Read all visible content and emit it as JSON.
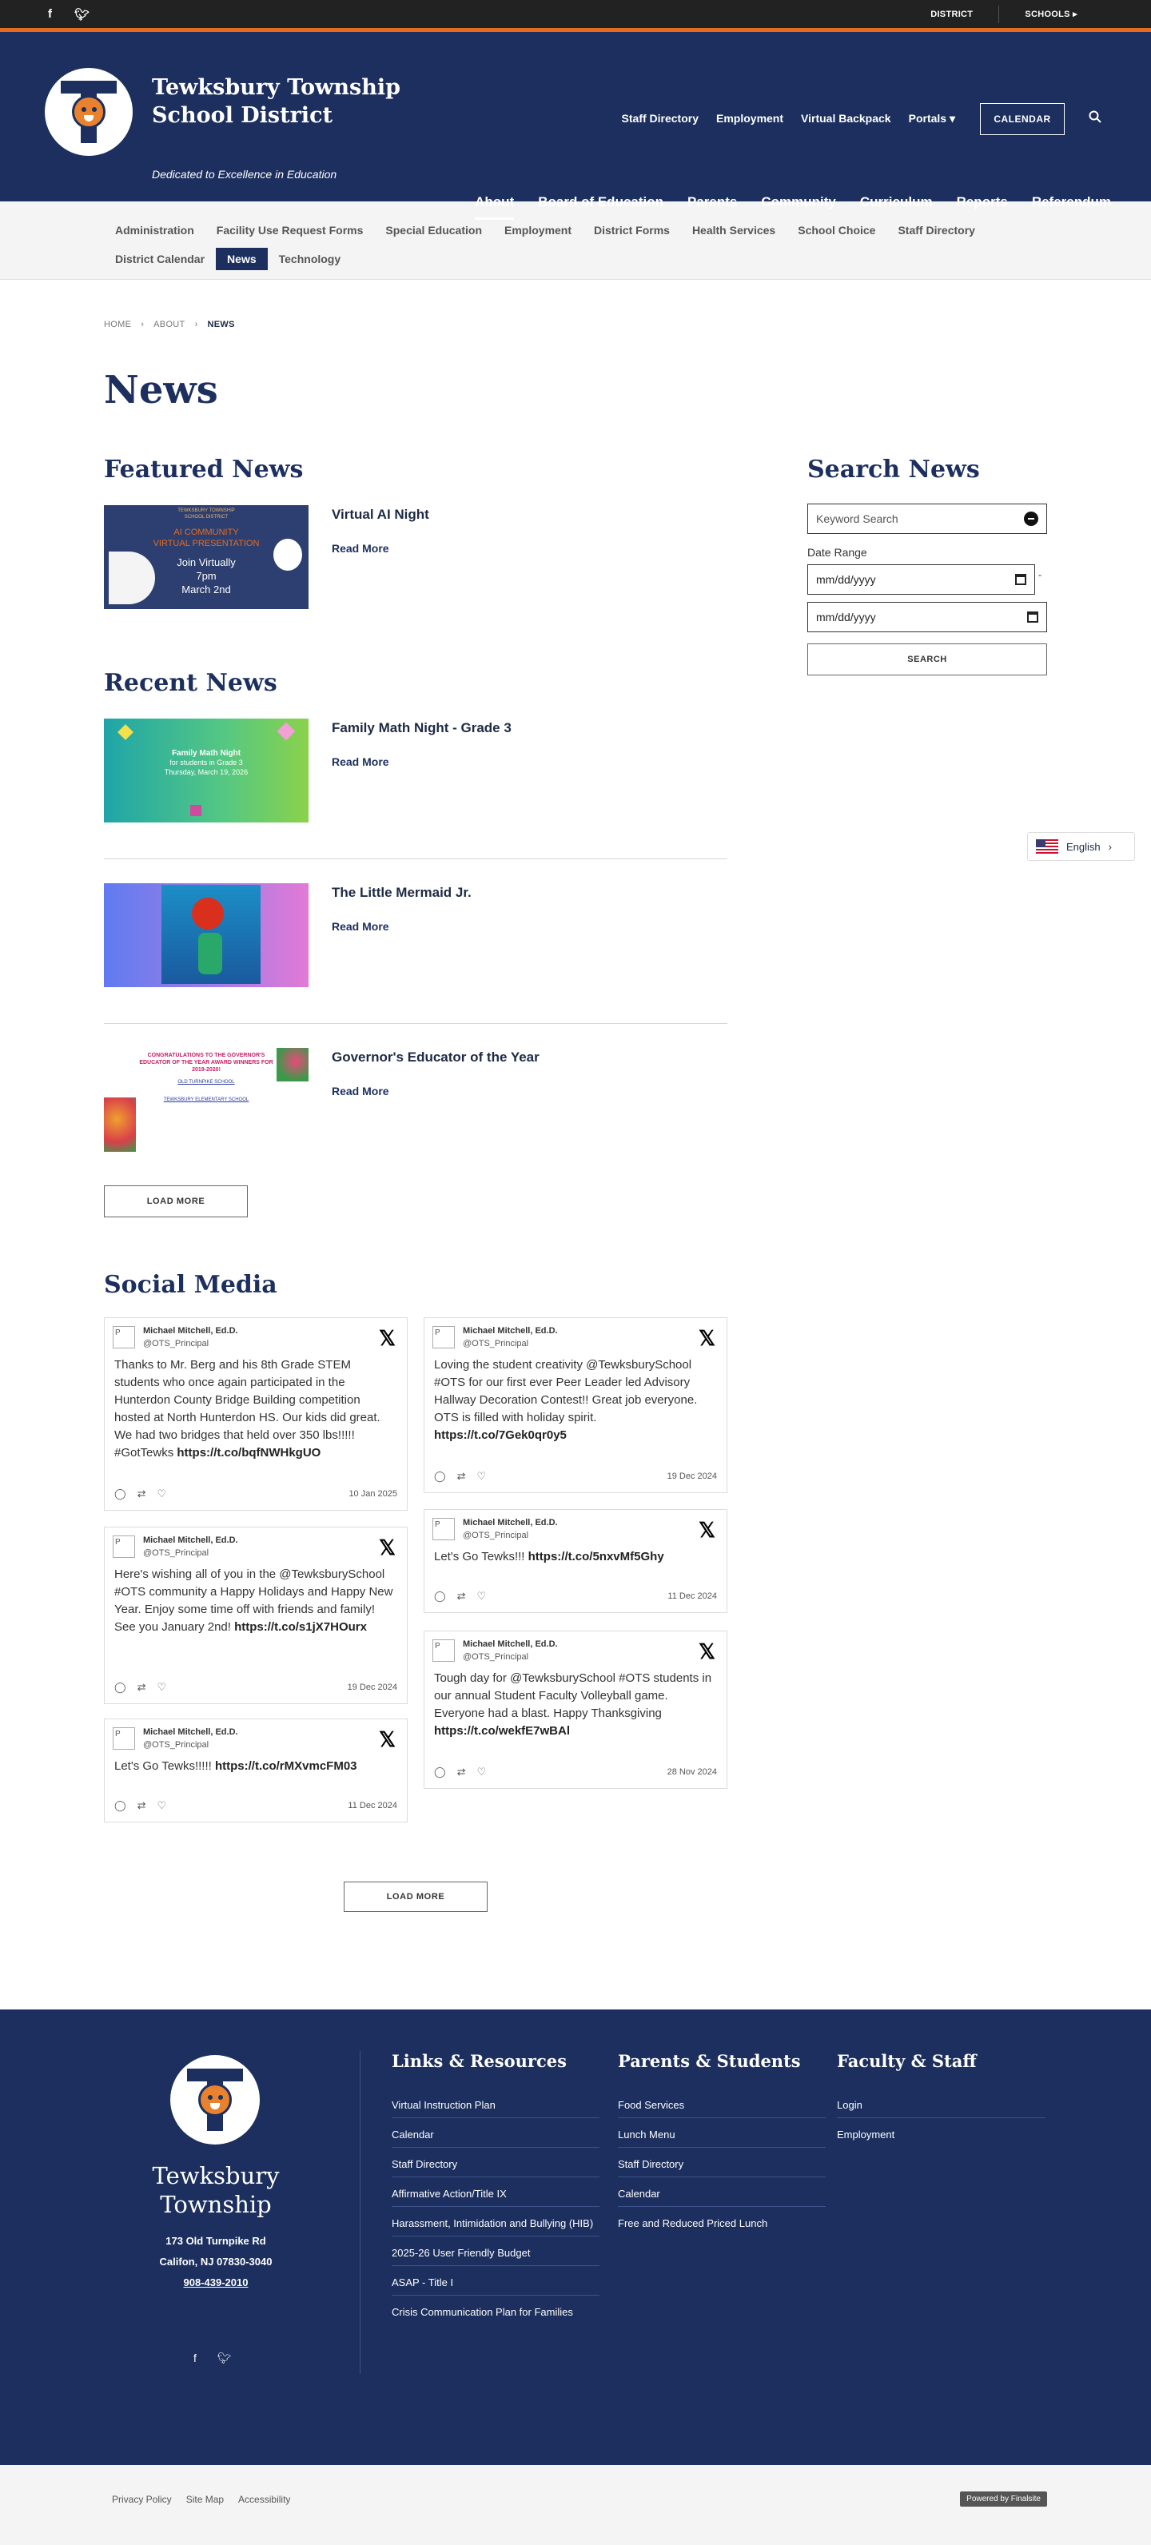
{
  "topbar": {
    "facebook_icon": "facebook-icon",
    "twitter_icon": "twitter-icon",
    "district": "DISTRICT",
    "schools": "SCHOOLS ▸"
  },
  "header": {
    "title_line1": "Tewksbury Township",
    "title_line2": "School District",
    "tagline": "Dedicated to Excellence in Education",
    "util_nav": [
      "Staff Directory",
      "Employment",
      "Virtual Backpack",
      "Portals ▾"
    ],
    "calendar": "CALENDAR",
    "main_nav": [
      "About",
      "Board of Education",
      "Parents",
      "Community",
      "Curriculum",
      "Reports",
      "Referendum"
    ]
  },
  "subnav": {
    "row1": [
      "Administration",
      "Facility Use Request Forms",
      "Special Education",
      "Employment",
      "District Forms",
      "Health Services",
      "School Choice",
      "Staff Directory"
    ],
    "row2": [
      "District Calendar",
      "News",
      "Technology"
    ]
  },
  "breadcrumb": [
    "HOME",
    "ABOUT",
    "NEWS"
  ],
  "page_title": "News",
  "featured": {
    "heading": "Featured News",
    "item": {
      "title": "Virtual AI Night",
      "read_more": "Read More",
      "thumb_lines": [
        "TEWKSBURY TOWNSHIP",
        "SCHOOL DISTRICT",
        "AI COMMUNITY",
        "VIRTUAL PRESENTATION",
        "Join Virtually",
        "7pm",
        "March 2nd"
      ]
    }
  },
  "recent": {
    "heading": "Recent News",
    "items": [
      {
        "title": "Family Math Night - Grade 3",
        "read_more": "Read More",
        "thumb_lines": [
          "Family Math Night",
          "for students in Grade 3",
          "Thursday, March 19, 2026"
        ]
      },
      {
        "title": "The Little Mermaid Jr.",
        "read_more": "Read More"
      },
      {
        "title": "Governor's Educator of the Year",
        "read_more": "Read More",
        "thumb_lines": [
          "CONGRATULATIONS TO THE GOVERNOR'S",
          "EDUCATOR OF THE YEAR AWARD WINNERS FOR",
          "2019-2020!",
          "OLD TURNPIKE SCHOOL",
          "TEWKSBURY ELEMENTARY SCHOOL"
        ]
      }
    ],
    "load_more": "LOAD MORE"
  },
  "search": {
    "heading": "Search News",
    "keyword_placeholder": "Keyword Search",
    "date_label": "Date Range",
    "date_placeholder": "mm/dd/yyyy",
    "button": "SEARCH"
  },
  "language": "English",
  "social": {
    "heading": "Social Media",
    "load_more": "LOAD MORE",
    "tweets": [
      {
        "name": "Michael Mitchell, Ed.D.",
        "handle": "@OTS_Principal",
        "text": "Thanks to Mr. Berg and his 8th Grade STEM students who once again participated in the Hunterdon County Bridge Building competition hosted at North Hunterdon HS. Our kids did great. We had two bridges that held over 350 lbs!!!!! #GotTewks",
        "link": "https://t.co/bqfNWHkgUO",
        "date": "10 Jan 2025"
      },
      {
        "name": "Michael Mitchell, Ed.D.",
        "handle": "@OTS_Principal",
        "text": "Loving the student creativity @TewksburySchool #OTS for our first ever Peer Leader led Advisory Hallway Decoration Contest!! Great job everyone. OTS is filled with holiday spirit.",
        "link": "https://t.co/7Gek0qr0y5",
        "date": "19 Dec 2024"
      },
      {
        "name": "Michael Mitchell, Ed.D.",
        "handle": "@OTS_Principal",
        "text": "Here's wishing all of you in the @TewksburySchool #OTS community a Happy Holidays and Happy New Year. Enjoy some time off with friends and family! See you January 2nd!",
        "link": "https://t.co/s1jX7HOurx",
        "date": "19 Dec 2024"
      },
      {
        "name": "Michael Mitchell, Ed.D.",
        "handle": "@OTS_Principal",
        "text": "Let's Go Tewks!!!",
        "link": "https://t.co/5nxvMf5Ghy",
        "date": "11 Dec 2024"
      },
      {
        "name": "Michael Mitchell, Ed.D.",
        "handle": "@OTS_Principal",
        "text": "Let's Go Tewks!!!!!",
        "link": "https://t.co/rMXvmcFM03",
        "date": "11 Dec 2024"
      },
      {
        "name": "Michael Mitchell, Ed.D.",
        "handle": "@OTS_Principal",
        "text": "Tough day for @TewksburySchool #OTS students in our annual Student Faculty Volleyball game. Everyone had a blast. Happy Thanksgiving",
        "link": "https://t.co/wekfE7wBAl",
        "date": "28 Nov 2024"
      }
    ]
  },
  "footer": {
    "name_line1": "Tewksbury",
    "name_line2": "Township",
    "address1": "173 Old Turnpike Rd",
    "address2": "Califon, NJ  07830-3040",
    "phone": "908-439-2010",
    "links_resources": {
      "heading": "Links & Resources",
      "links": [
        "Virtual Instruction Plan",
        "Calendar",
        "Staff Directory",
        "Affirmative Action/Title IX",
        "Harassment, Intimidation and Bullying (HIB)",
        "2025-26 User Friendly Budget",
        "ASAP - Title I",
        "Crisis Communication Plan for Families"
      ]
    },
    "parents_students": {
      "heading": "Parents & Students",
      "links": [
        "Food Services",
        "Lunch Menu",
        "Staff Directory",
        "Calendar",
        "Free and Reduced Priced Lunch"
      ]
    },
    "faculty_staff": {
      "heading": "Faculty & Staff",
      "links": [
        "Login",
        "Employment"
      ]
    }
  },
  "bottom": {
    "links": [
      "Privacy Policy",
      "Site Map",
      "Accessibility"
    ],
    "powered": "Powered by Finalsite"
  },
  "colors": {
    "navy": "#1c2f5e",
    "accent_orange": "#e56b1f"
  }
}
